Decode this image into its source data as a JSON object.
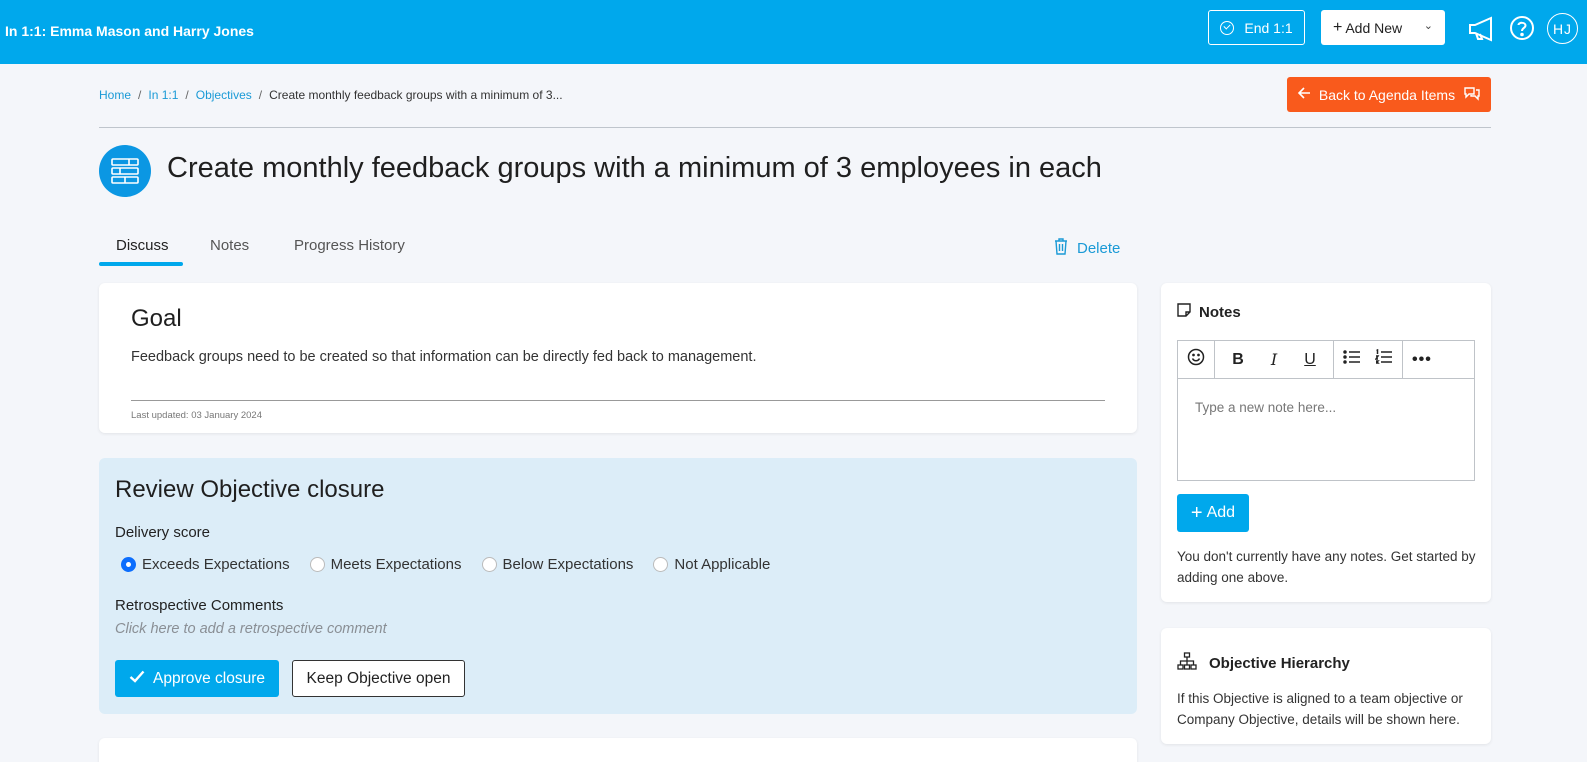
{
  "topbar": {
    "title": "In 1:1: Emma Mason and Harry Jones",
    "end_label": "End 1:1",
    "add_new_label": "Add New",
    "avatar_initials": "HJ",
    "brand_color": "#00a8ec"
  },
  "breadcrumb": {
    "items": [
      "Home",
      "In 1:1",
      "Objectives"
    ],
    "current": "Create monthly feedback groups with a minimum of 3..."
  },
  "back_button": {
    "label": "Back to Agenda Items",
    "color": "#f95a1c"
  },
  "page": {
    "title": "Create monthly feedback groups with a minimum of 3 employees in each"
  },
  "tabs": [
    {
      "label": "Discuss",
      "active": true
    },
    {
      "label": "Notes",
      "active": false
    },
    {
      "label": "Progress History",
      "active": false
    }
  ],
  "delete_label": "Delete",
  "goal": {
    "heading": "Goal",
    "text": "Feedback groups need to be created so that information can be directly fed back to management.",
    "last_updated": "Last updated: 03 January 2024"
  },
  "review": {
    "heading": "Review Objective closure",
    "delivery_label": "Delivery score",
    "options": [
      {
        "label": "Exceeds Expectations",
        "selected": true
      },
      {
        "label": "Meets Expectations",
        "selected": false
      },
      {
        "label": "Below Expectations",
        "selected": false
      },
      {
        "label": "Not Applicable",
        "selected": false
      }
    ],
    "comments_label": "Retrospective Comments",
    "comments_placeholder": "Click here to add a retrospective comment",
    "approve_label": "Approve closure",
    "keep_label": "Keep Objective open"
  },
  "notes": {
    "heading": "Notes",
    "placeholder": "Type a new note here...",
    "add_label": "Add",
    "empty_text": "You don't currently have any notes. Get started by adding one above."
  },
  "hierarchy": {
    "heading": "Objective Hierarchy",
    "text": "If this Objective is aligned to a team objective or Company Objective, details will be shown here."
  }
}
